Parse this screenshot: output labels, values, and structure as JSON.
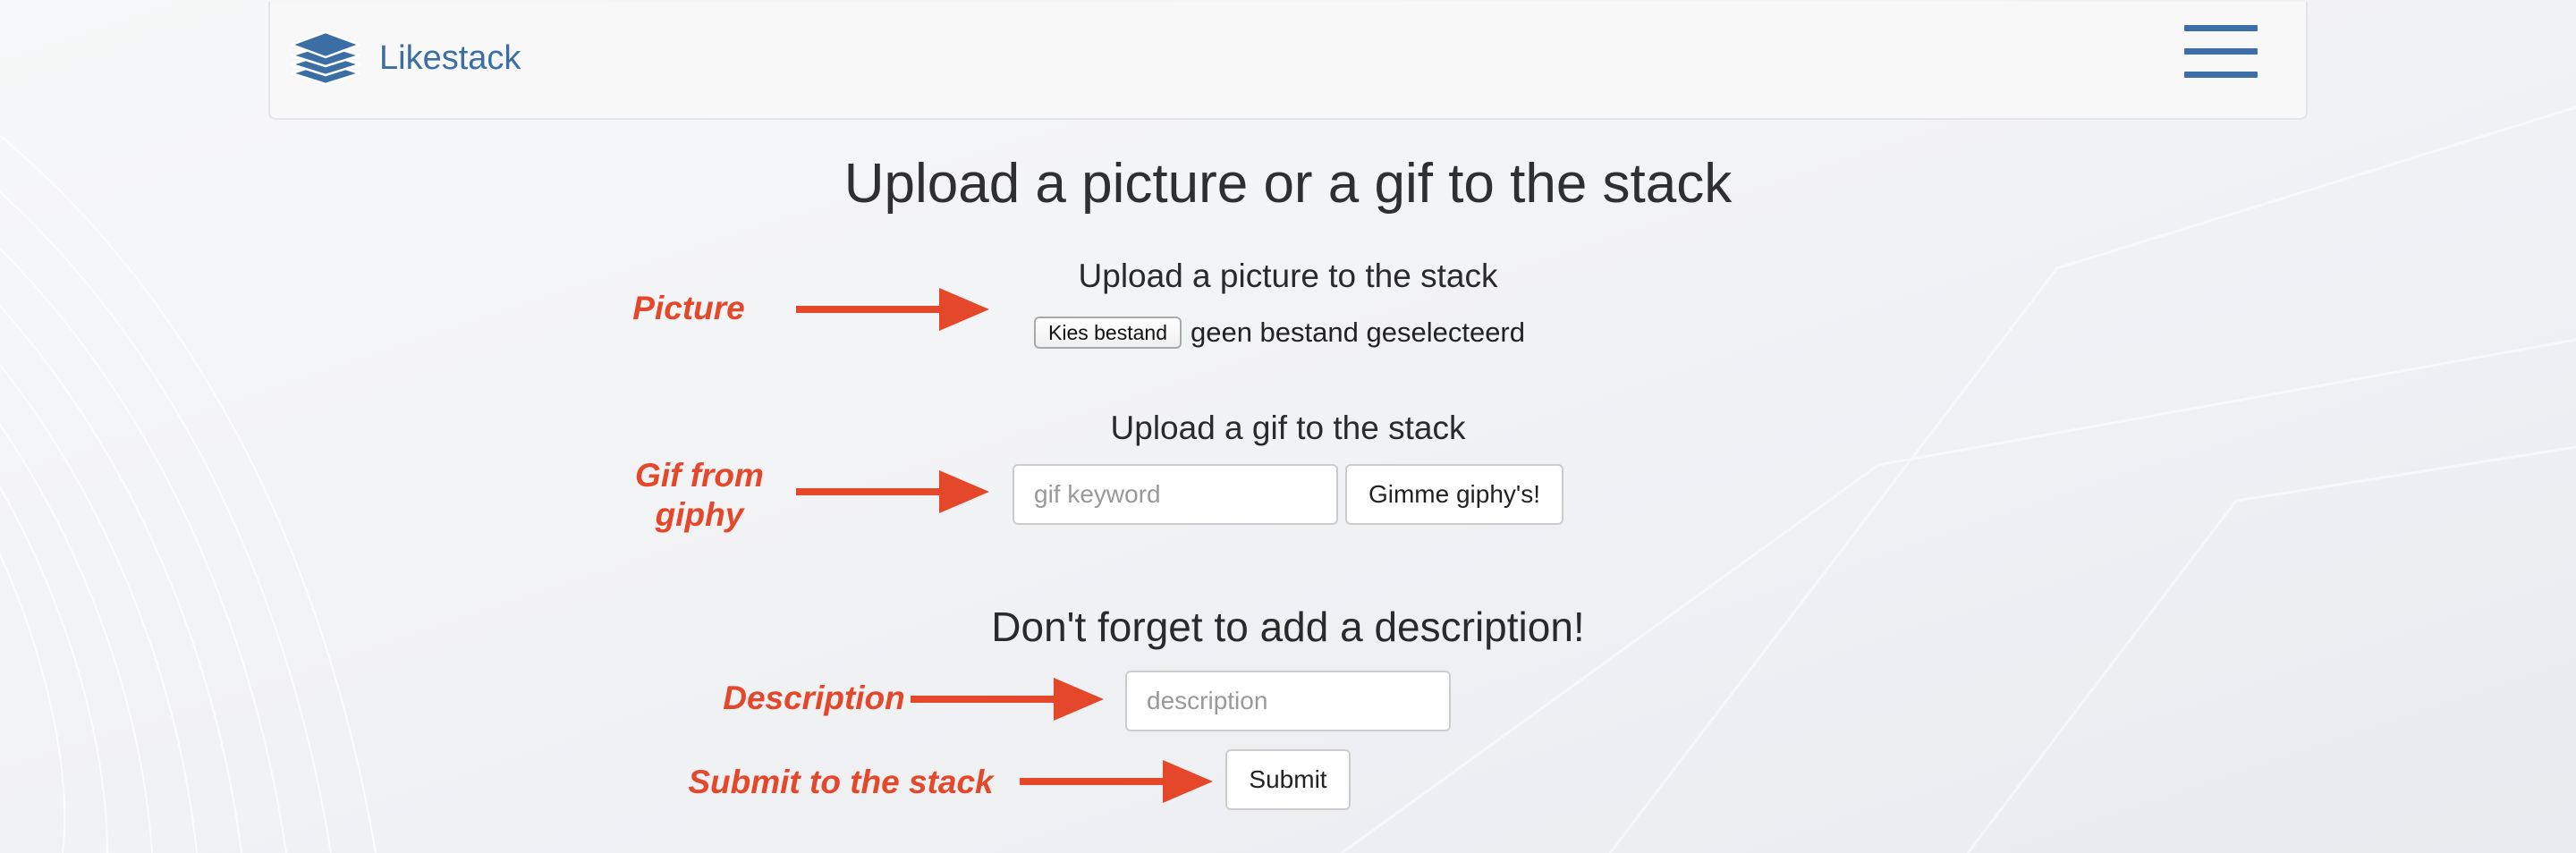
{
  "brand": {
    "name": "Likestack",
    "icon": "stack-layers-icon"
  },
  "nav": {
    "menu_icon": "hamburger-menu-icon"
  },
  "page": {
    "title": "Upload a picture or a gif to the stack"
  },
  "picture_section": {
    "heading": "Upload a picture to the stack",
    "file_button_label": "Kies bestand",
    "file_status": "geen bestand geselecteerd"
  },
  "gif_section": {
    "heading": "Upload a gif to the stack",
    "keyword_placeholder": "gif keyword",
    "search_button_label": "Gimme giphy's!"
  },
  "description_section": {
    "heading": "Don't forget to add a description!",
    "description_placeholder": "description",
    "submit_label": "Submit"
  },
  "annotations": {
    "picture": "Picture",
    "gif_line1": "Gif from",
    "gif_line2": "giphy",
    "description": "Description",
    "submit": "Submit to the stack"
  },
  "colors": {
    "brand_blue": "#3a6ea5",
    "annotation_red": "#e5472b",
    "navbar_bg": "#f8f8f8"
  }
}
